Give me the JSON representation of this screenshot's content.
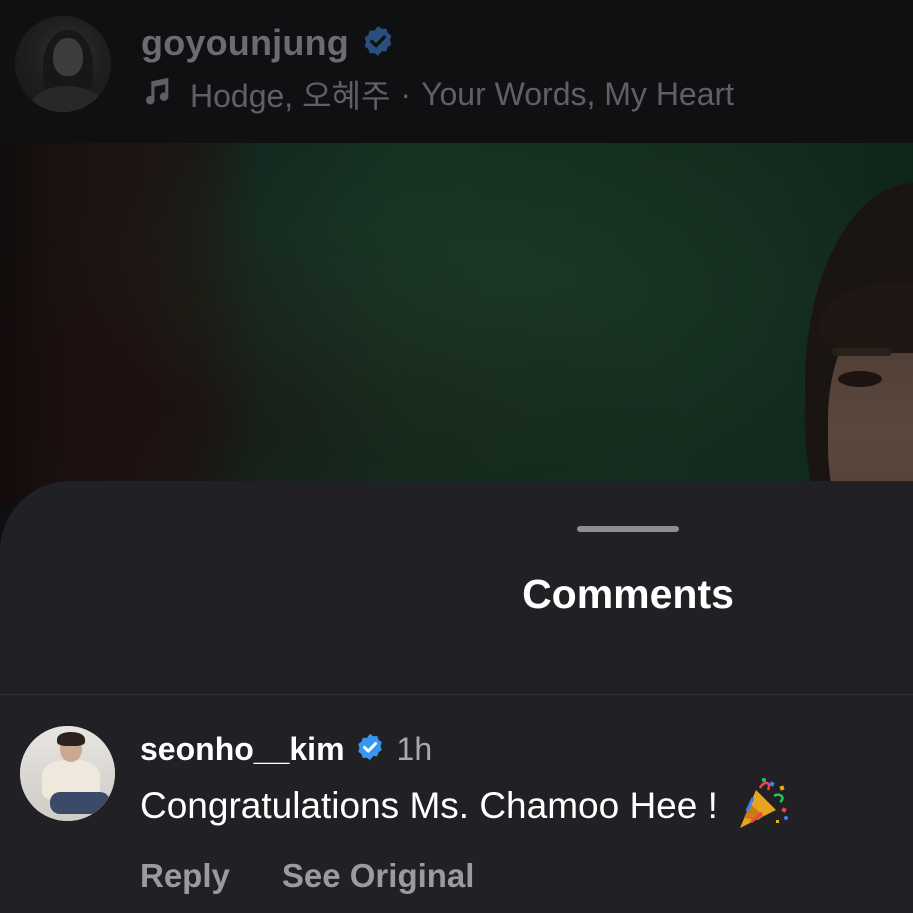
{
  "header": {
    "username": "goyounjung",
    "music": {
      "artist": "Hodge, 오혜주",
      "separator": "·",
      "song": "Your Words, My Heart"
    }
  },
  "sheet": {
    "title": "Comments"
  },
  "comment": {
    "username": "seonho__kim",
    "time": "1h",
    "text": "Congratulations Ms. Chamoo Hee !",
    "emoji_icon": "party-popper-icon",
    "actions": {
      "reply": "Reply",
      "see_original": "See Original"
    }
  },
  "colors": {
    "sheet_background": "#212125",
    "verified_badge": "#3797f0",
    "verified_badge_dimmed": "#2a4f7e",
    "header_text_dimmed": "#6b6c70",
    "secondary_text": "#9a9ba0"
  }
}
